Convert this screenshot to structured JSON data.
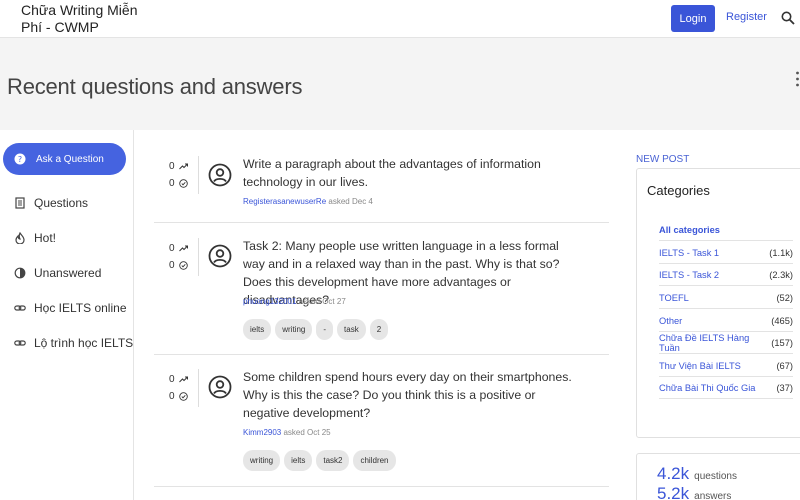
{
  "header": {
    "site_title": "Chữa Writing Miễn Phí - CWMP",
    "login_label": "Login",
    "register_label": "Register"
  },
  "page_title": "Recent questions and answers",
  "sidebar": {
    "ask_label": "Ask a Question",
    "items": [
      {
        "label": "Questions",
        "icon": "document-icon"
      },
      {
        "label": "Hot!",
        "icon": "fire-icon"
      },
      {
        "label": "Unanswered",
        "icon": "half-circle-icon"
      },
      {
        "label": "Học IELTS online",
        "icon": "link-icon"
      },
      {
        "label": "Lộ trình học IELTS",
        "icon": "link-icon"
      }
    ]
  },
  "questions": [
    {
      "votes": "0",
      "answers": "0",
      "title": "Write a paragraph about the advantages of information technology in our lives.",
      "user": "RegisterasanewuserRe",
      "asked": "asked Dec 4",
      "tags": []
    },
    {
      "votes": "0",
      "answers": "0",
      "title": "Task 2: Many people use written language in a less formal way and in a relaxed way than in the past. Why is that so? Does this development have more advantages or disadvantages?",
      "user": "phuong132001",
      "asked": "asked Oct 27",
      "tags": [
        "ielts",
        "writing",
        "-",
        "task",
        "2"
      ]
    },
    {
      "votes": "0",
      "answers": "0",
      "title": "Some children spend hours every day on their smartphones. Why is this the case? Do you think this is a positive or negative development?",
      "user": "Kimm2903",
      "asked": "asked Oct 25",
      "tags": [
        "writing",
        "ielts",
        "task2",
        "children"
      ]
    }
  ],
  "right": {
    "new_post": "NEW POST",
    "categories_title": "Categories",
    "categories": [
      {
        "name": "All categories",
        "count": ""
      },
      {
        "name": "IELTS - Task 1",
        "count": "(1.1k)"
      },
      {
        "name": "IELTS - Task 2",
        "count": "(2.3k)"
      },
      {
        "name": "TOEFL",
        "count": "(52)"
      },
      {
        "name": "Other",
        "count": "(465)"
      },
      {
        "name": "Chữa Đề IELTS Hàng Tuần",
        "count": "(157)"
      },
      {
        "name": "Thư Viện Bài IELTS",
        "count": "(67)"
      },
      {
        "name": "Chữa Bài Thi Quốc Gia",
        "count": "(37)"
      }
    ],
    "stats": [
      {
        "num": "4.2k",
        "label": "questions"
      },
      {
        "num": "5.2k",
        "label": "answers"
      }
    ]
  },
  "colors": {
    "accent": "#3a55d8",
    "ask_button": "#4563e0"
  }
}
